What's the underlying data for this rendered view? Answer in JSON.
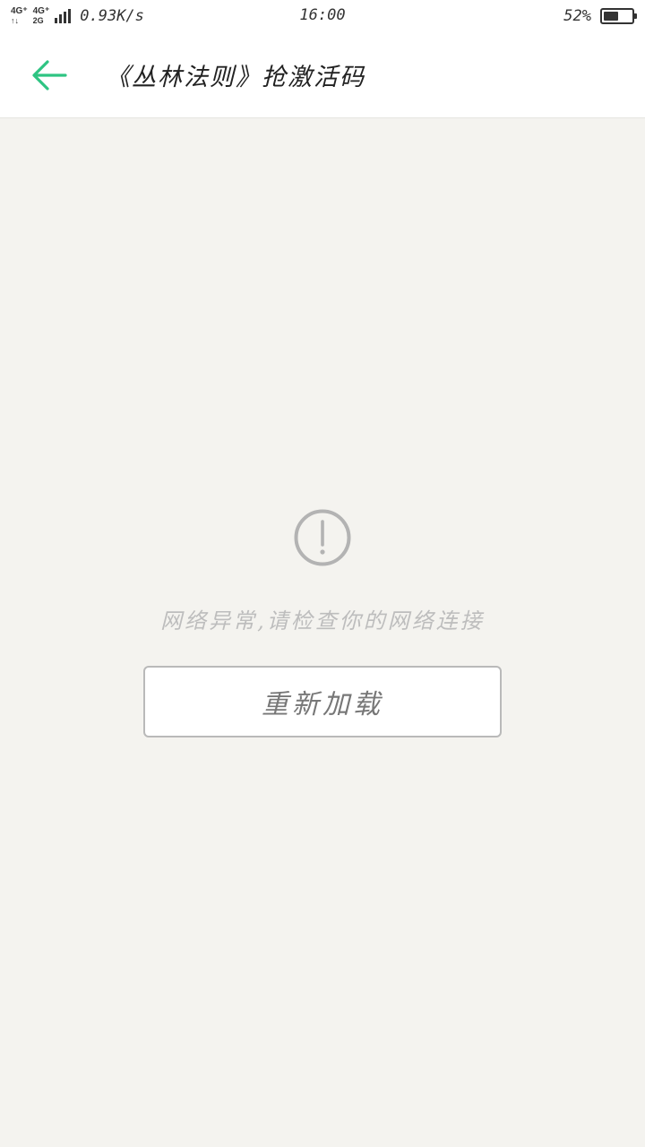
{
  "status_bar": {
    "network_1": "4G⁺",
    "network_1_sub": "↑↓",
    "network_2": "4G⁺",
    "network_2_sub": "2G",
    "speed": "0.93K/s",
    "time": "16:00",
    "battery": "52%",
    "battery_level": 0.52
  },
  "header": {
    "title": "《丛林法则》抢激活码"
  },
  "error": {
    "message": "网络异常,请检查你的网络连接",
    "reload_label": "重新加载"
  },
  "colors": {
    "accent": "#2ec482",
    "background": "#f4f3ef",
    "icon_gray": "#b3b3b3"
  }
}
